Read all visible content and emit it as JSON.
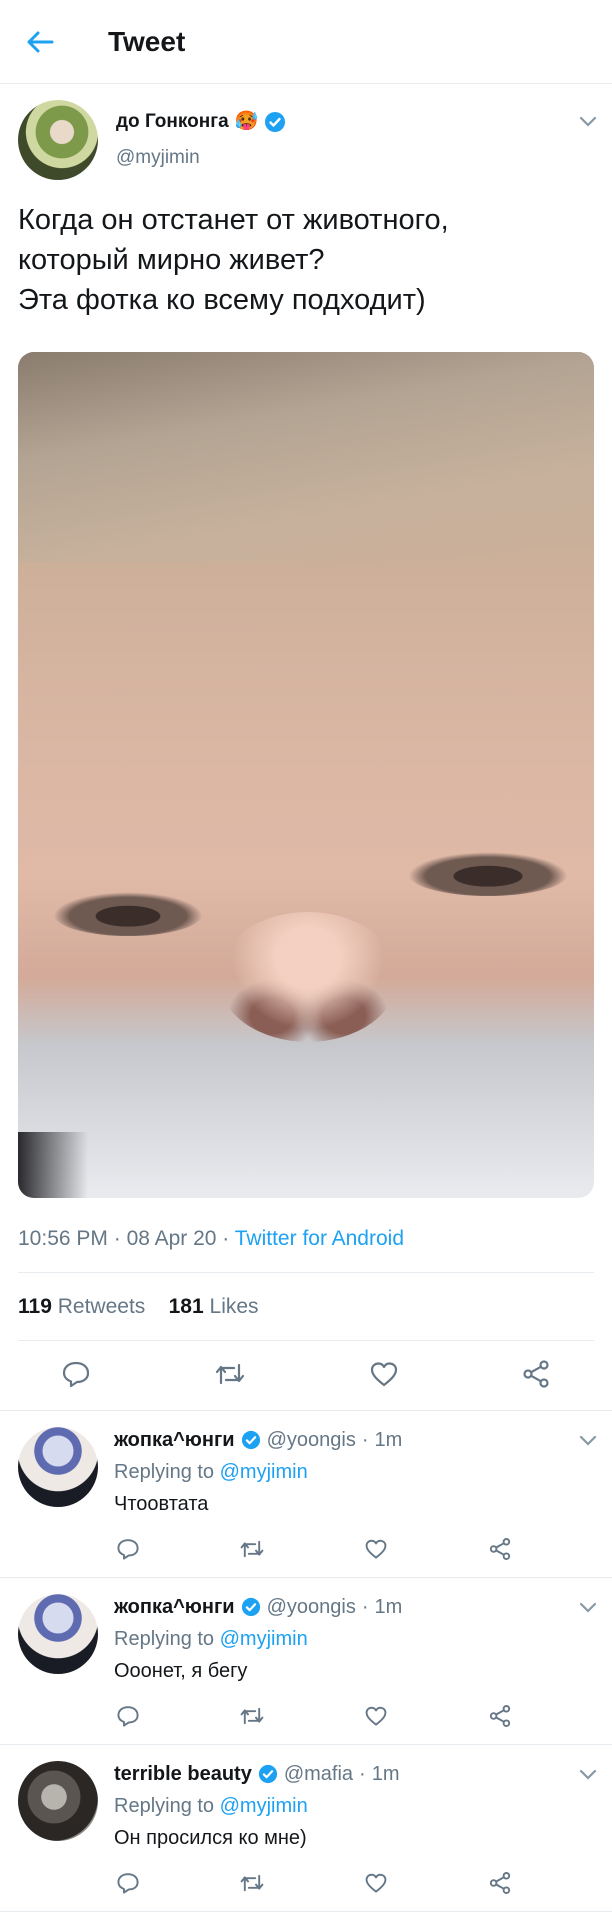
{
  "header": {
    "title": "Tweet",
    "back_icon": "arrow-left-icon"
  },
  "colors": {
    "accent": "#1da1f2",
    "verified": "#1da1f2",
    "secondary_text": "#657786",
    "divider": "#e6ecf0"
  },
  "tweet": {
    "author_name": "до Гонконга",
    "author_emoji": "🥵",
    "author_handle": "@myjimin",
    "text_lines": [
      "Когда он отстанет от животного,",
      "который мирно живет?",
      "Эта фотка ко всему подходит)"
    ],
    "time": "10:56 PM",
    "sep1": " · ",
    "date": "08 Apr 20",
    "sep2": " · ",
    "source": "Twitter for Android",
    "retweets_count": "119",
    "retweets_label": "Retweets",
    "likes_count": "181",
    "likes_label": "Likes"
  },
  "replies": [
    {
      "name": "жопка^юнги",
      "handle": "@yoongis",
      "dot": " · ",
      "time": "1m",
      "replying_label": "Replying to",
      "replying_to": "@myjimin",
      "text": "Чтоовтата"
    },
    {
      "name": "жопка^юнги",
      "handle": "@yoongis",
      "dot": " · ",
      "time": "1m",
      "replying_label": "Replying to",
      "replying_to": "@myjimin",
      "text": "Ооонет, я бегу"
    },
    {
      "name": "terrible beauty",
      "handle": "@mafia",
      "dot": " · ",
      "time": "1m",
      "replying_label": "Replying to",
      "replying_to": "@myjimin",
      "text": "Он просился ко мне)"
    }
  ]
}
